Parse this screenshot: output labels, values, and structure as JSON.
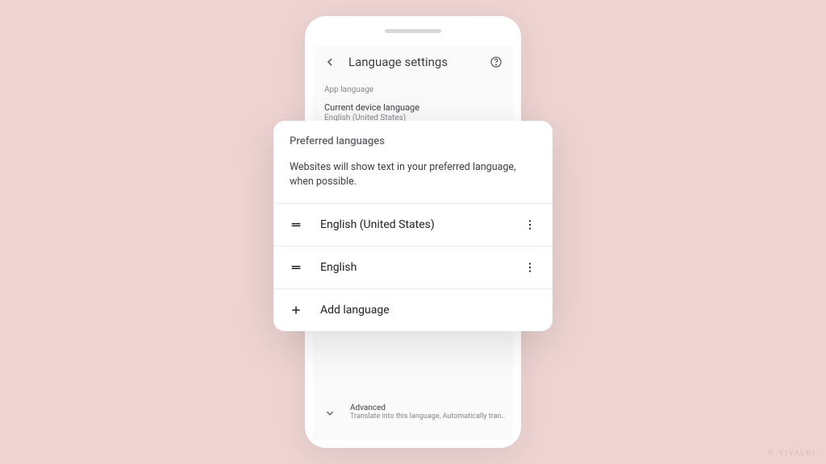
{
  "screen": {
    "title": "Language settings",
    "section_app_language": "App language",
    "current_device": {
      "title": "Current device language",
      "value": "English (United States)"
    },
    "advanced": {
      "title": "Advanced",
      "description": "Translate into this language, Automatically tran.."
    }
  },
  "card": {
    "title": "Preferred languages",
    "description": "Websites will show text in your preferred language, when possible.",
    "languages": [
      "English (United States)",
      "English"
    ],
    "add_label": "Add language"
  },
  "watermark": "© VIVALDI"
}
